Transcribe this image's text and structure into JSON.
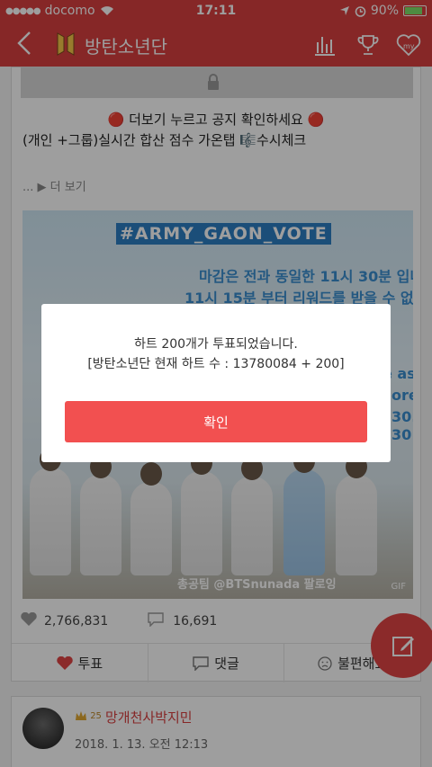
{
  "status_bar": {
    "signal_dots": "●●●●●",
    "carrier": "docomo",
    "wifi_icon": "wifi-icon",
    "time": "17:11",
    "location_icon": "location-arrow-icon",
    "alarm_icon": "alarm-icon",
    "battery": "90%"
  },
  "nav": {
    "back_icon": "chevron-left-icon",
    "logo_icon": "group-logo-icon",
    "title": "방탄소년단",
    "icons": [
      "chart-icon",
      "trophy-icon",
      "my-heart-icon"
    ],
    "my_label": "my"
  },
  "post": {
    "line1": "🔴 더보기 누르고 공지 확인하세요 🔴",
    "line2": "(개인 +그룹)실시간 합산 점수 가온탭 🎼수시체크",
    "more": "... ▶ 더 보기",
    "banner": {
      "hashtag": "#ARMY_GAON_VOTE",
      "text_1": "마감은 전과 동일한 11시 30분 입니",
      "text_2": "11시 15분 부터 리워드를 받을 수 없는",
      "text_3": "e as",
      "text_4": "ore",
      "text_5": "30.",
      "text_6": "30",
      "credit": "총공팀 @BTSnunada 팔로잉",
      "gif": "GIF"
    },
    "likes": "2,766,831",
    "comments": "16,691",
    "actions": {
      "vote": "투표",
      "comment": "댓글",
      "uncomfortable": "불편해요"
    }
  },
  "next_post": {
    "badge_level": "25",
    "username": "망개천사박지민",
    "date": "2018. 1. 13. 오전 12:13"
  },
  "dialog": {
    "message_1": "하트 200개가 투표되었습니다.",
    "message_2": "[방탄소년단 현재 하트 수 : 13780084 + 200]",
    "confirm": "확인"
  },
  "colors": {
    "brand": "#d94040",
    "confirm": "#f25050",
    "banner_blue": "#2d7fc3"
  }
}
